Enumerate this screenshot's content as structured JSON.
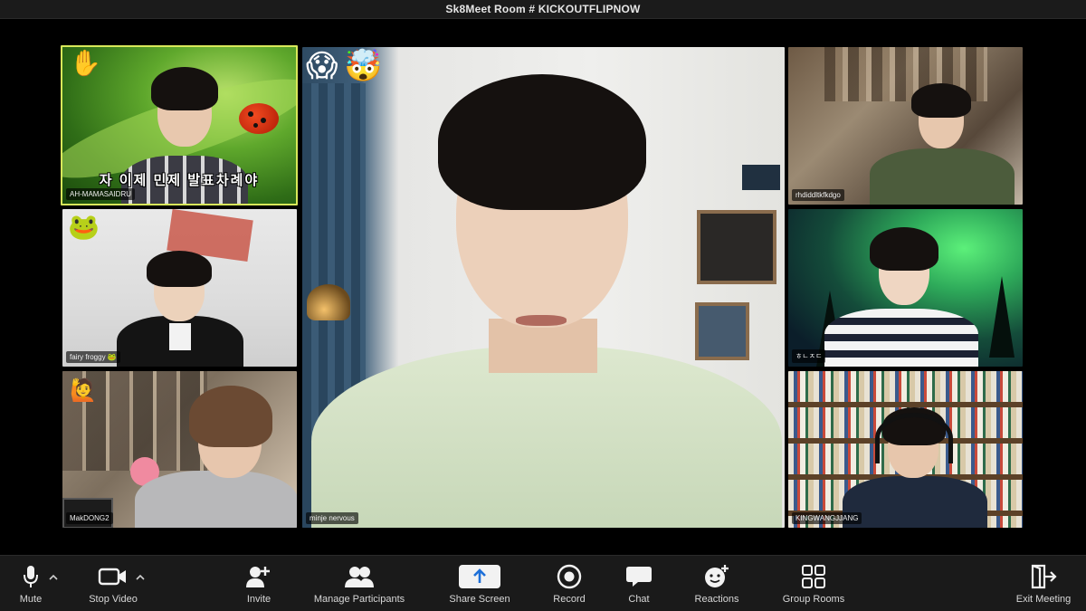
{
  "window": {
    "title": "Sk8Meet Room # KICKOUTFLIPNOW"
  },
  "tiles": [
    {
      "name": "AH-MAMASAIDRU",
      "emoji": "✋",
      "subtitle": "자 이제 민제 발표차례야",
      "active_speaker": true
    },
    {
      "name": "fairy froggy 🐸",
      "emoji": "🐸"
    },
    {
      "name": "MakDONG2",
      "emoji": "🙋"
    },
    {
      "name": "minje nervous",
      "emojis": [
        "😱",
        "🤯"
      ]
    },
    {
      "name": "rhdiddltkfkdgo"
    },
    {
      "name": "ㅎㄴㅈㄷ"
    },
    {
      "name": "KINGWANGJJANG"
    }
  ],
  "toolbar": {
    "mute": "Mute",
    "stop_video": "Stop Video",
    "invite": "Invite",
    "manage_participants": "Manage Participants",
    "share_screen": "Share Screen",
    "record": "Record",
    "chat": "Chat",
    "reactions": "Reactions",
    "group_rooms": "Group Rooms",
    "exit_meeting": "Exit Meeting"
  },
  "icons": {
    "mute": "microphone-icon",
    "stop_video": "video-camera-icon",
    "invite": "add-user-icon",
    "manage_participants": "participants-icon",
    "share_screen": "share-screen-icon",
    "record": "record-icon",
    "chat": "chat-bubble-icon",
    "reactions": "reactions-icon",
    "group_rooms": "group-rooms-icon",
    "exit_meeting": "exit-icon"
  },
  "colors": {
    "active_speaker_border": "#d8e85a",
    "toolbar_bg": "#1a1a1a",
    "share_button": "#f2f2f2"
  }
}
